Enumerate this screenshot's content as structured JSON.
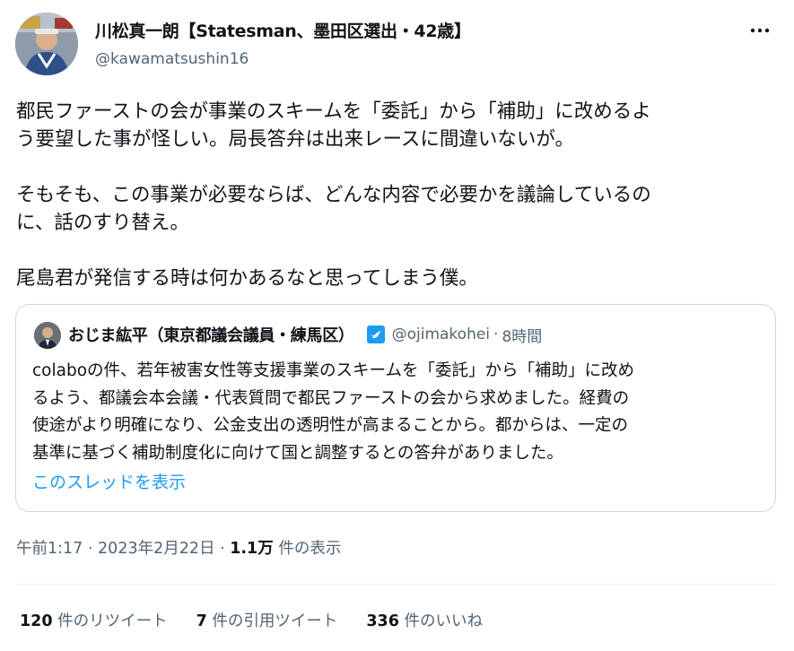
{
  "author": {
    "display_name": "川松真一朗【Statesman、墨田区選出・42歳】",
    "handle": "@kawamatsushin16"
  },
  "tweet": {
    "text": "都民ファーストの会が事業のスキームを「委託」から「補助」に改めるよ\nう要望した事が怪しい。局長答弁は出来レースに間違いないが。\n\nそもそも、この事業が必要ならば、どんな内容で必要かを議論しているの\nに、話のすり替え。\n\n尾島君が発信する時は何かあるなと思ってしまう僕。"
  },
  "quoted": {
    "display_name": "おじま紘平（東京都議会議員・練馬区）",
    "handle": "@ojimakohei",
    "separator": "·",
    "time": "8時間",
    "text": "colaboの件、若年被害女性等支援事業のスキームを「委託」から「補助」に改め\nるよう、都議会本会議・代表質問で都民ファーストの会から求めました。経費の\n使途がより明確になり、公金支出の透明性が高まることから。都からは、一定の\n基準に基づく補助制度化に向けて国と調整するとの答弁がありました。",
    "thread_link": "このスレッドを表示"
  },
  "meta": {
    "time": "午前1:17",
    "sep1": "·",
    "date": "2023年2月22日",
    "sep2": "·",
    "views": "1.1万",
    "views_label": "件の表示"
  },
  "stats": {
    "retweets": "120",
    "retweets_label": "件のリツイート",
    "quotes": "7",
    "quotes_label": "件の引用ツイート",
    "likes": "336",
    "likes_label": "件のいいね"
  },
  "colors": {
    "text": "#0f1419",
    "secondary": "#536471",
    "link": "#1d9bf0",
    "border": "#cfd9de"
  },
  "icons": [
    "more-options-icon",
    "verified-badge-icon"
  ]
}
